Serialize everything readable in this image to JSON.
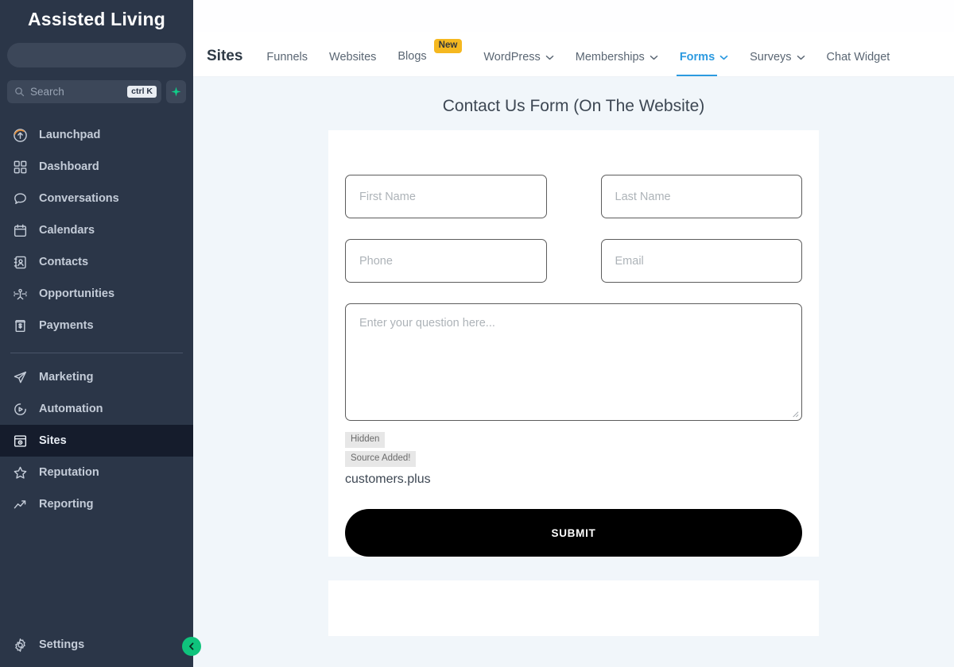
{
  "sidebar": {
    "brand": "Assisted Living",
    "search": {
      "placeholder": "Search",
      "shortcut": "ctrl K",
      "icon": "search-icon",
      "spark_icon": "spark-icon"
    },
    "items": [
      {
        "label": "Launchpad",
        "icon": "launchpad-icon",
        "active": false
      },
      {
        "label": "Dashboard",
        "icon": "dashboard-icon",
        "active": false
      },
      {
        "label": "Conversations",
        "icon": "conversations-icon",
        "active": false
      },
      {
        "label": "Calendars",
        "icon": "calendar-icon",
        "active": false
      },
      {
        "label": "Contacts",
        "icon": "contacts-icon",
        "active": false
      },
      {
        "label": "Opportunities",
        "icon": "opportunities-icon",
        "active": false
      },
      {
        "label": "Payments",
        "icon": "payments-icon",
        "active": false
      }
    ],
    "items2": [
      {
        "label": "Marketing",
        "icon": "marketing-icon",
        "active": false
      },
      {
        "label": "Automation",
        "icon": "automation-icon",
        "active": false
      },
      {
        "label": "Sites",
        "icon": "sites-icon",
        "active": true
      },
      {
        "label": "Reputation",
        "icon": "reputation-icon",
        "active": false
      },
      {
        "label": "Reporting",
        "icon": "reporting-icon",
        "active": false
      }
    ],
    "settings": {
      "label": "Settings",
      "icon": "gear-icon"
    },
    "collapse": {
      "icon": "chevron-left-icon",
      "color": "#0fc37c"
    }
  },
  "topnav": {
    "title": "Sites",
    "tabs": [
      {
        "label": "Funnels",
        "caret": false,
        "badge": "",
        "active": false
      },
      {
        "label": "Websites",
        "caret": false,
        "badge": "",
        "active": false
      },
      {
        "label": "Blogs",
        "caret": false,
        "badge": "New",
        "active": false
      },
      {
        "label": "WordPress",
        "caret": true,
        "badge": "",
        "active": false
      },
      {
        "label": "Memberships",
        "caret": true,
        "badge": "",
        "active": false
      },
      {
        "label": "Forms",
        "caret": true,
        "badge": "",
        "active": true
      },
      {
        "label": "Surveys",
        "caret": true,
        "badge": "",
        "active": false
      },
      {
        "label": "Chat Widget",
        "caret": false,
        "badge": "",
        "active": false
      }
    ],
    "active_color": "#2c9ae0",
    "badge_color": "#f5b820"
  },
  "form": {
    "title": "Contact Us Form (On The Website)",
    "fields": [
      {
        "name": "first-name",
        "placeholder": "First Name"
      },
      {
        "name": "last-name",
        "placeholder": "Last Name"
      },
      {
        "name": "phone",
        "placeholder": "Phone"
      },
      {
        "name": "email",
        "placeholder": "Email"
      }
    ],
    "question": {
      "placeholder": "Enter your question here..."
    },
    "hidden": {
      "tag_hidden": "Hidden",
      "tag_source": "Source Added!",
      "value": "customers.plus"
    },
    "submit_label": "SUBMIT"
  }
}
